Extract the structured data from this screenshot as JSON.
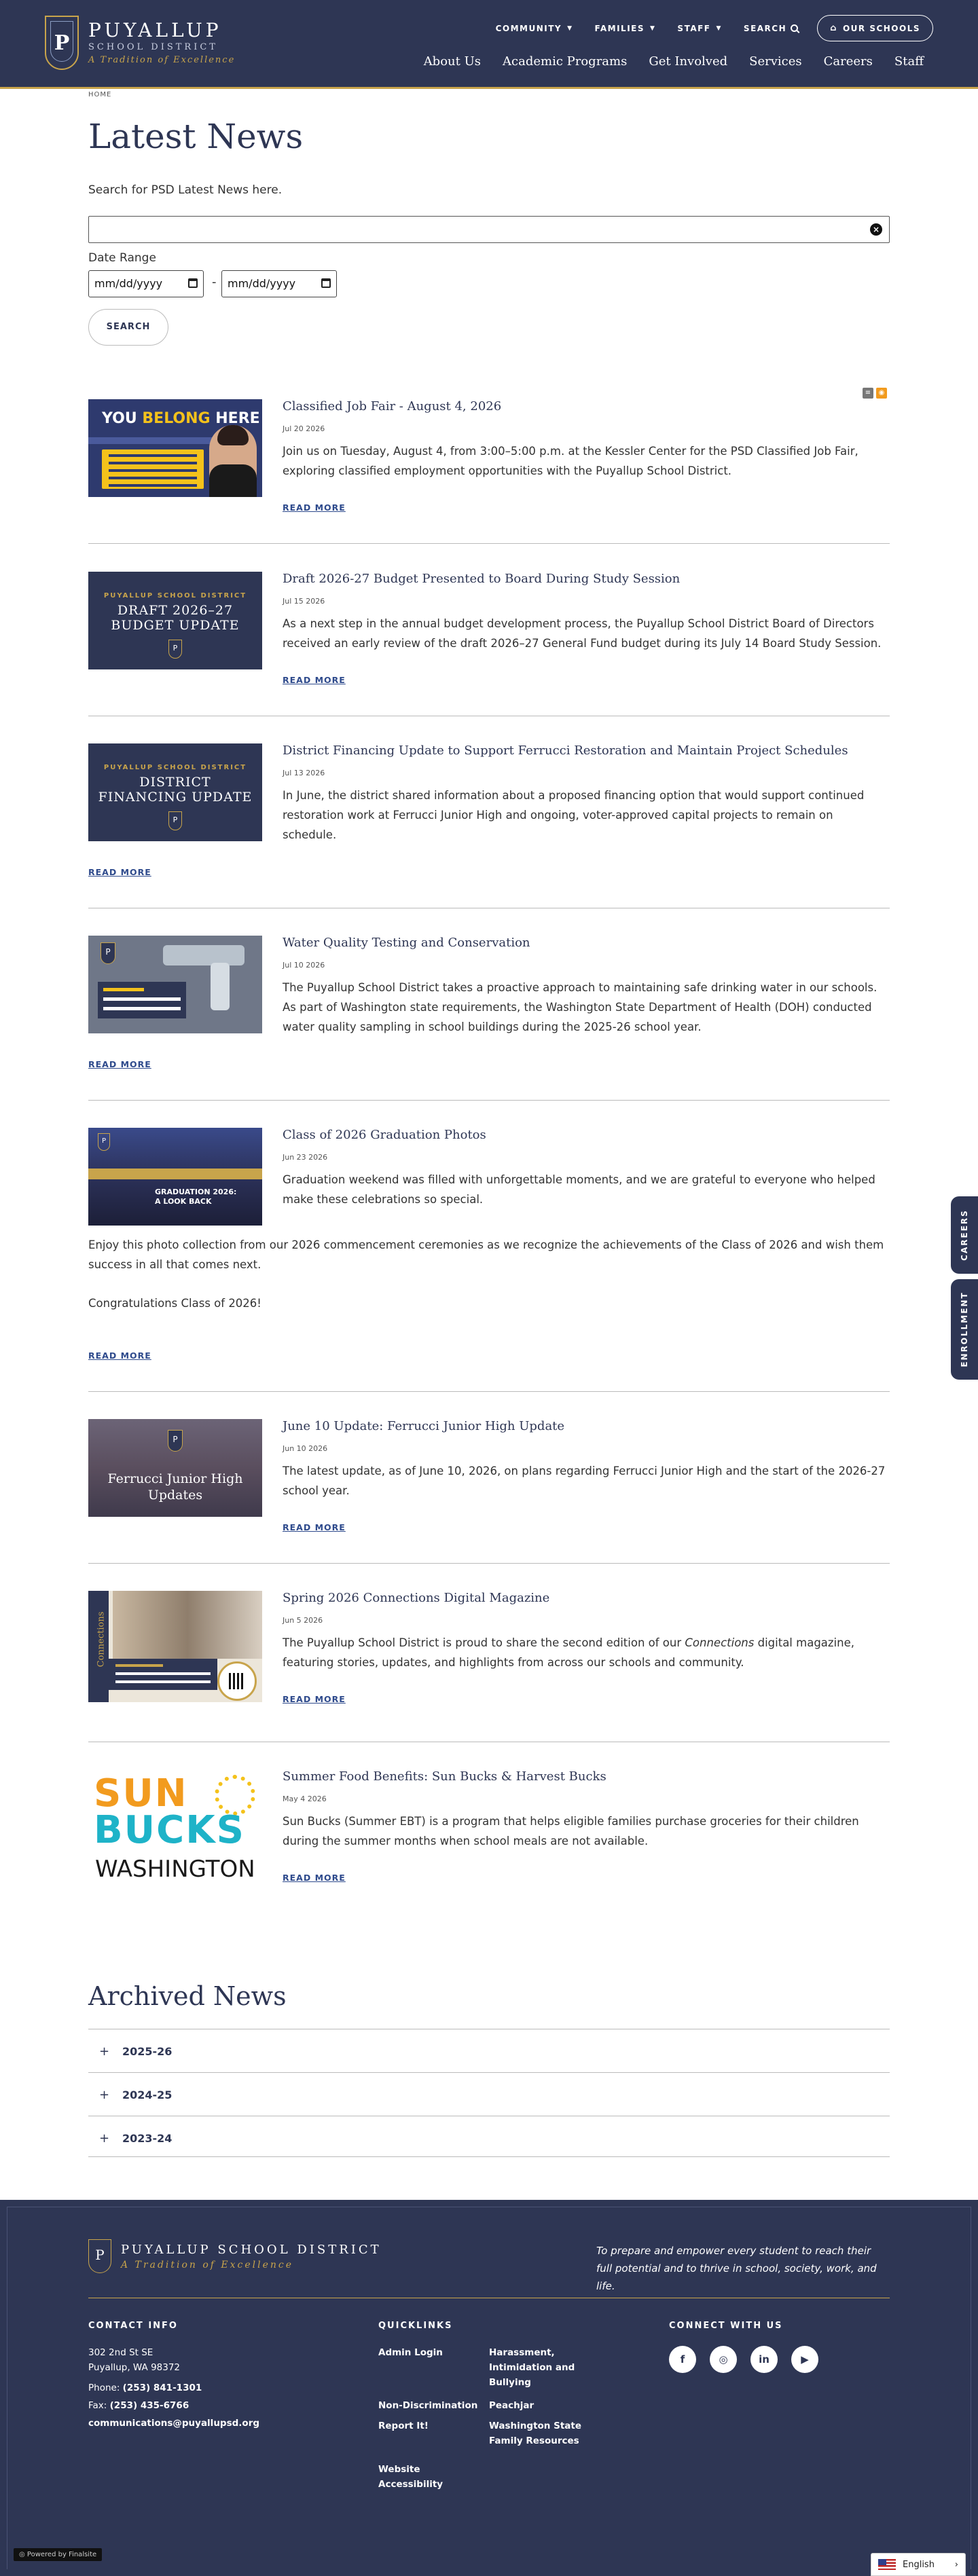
{
  "header": {
    "logo": {
      "name": "PUYALLUP",
      "sub": "SCHOOL DISTRICT",
      "tagline": "A Tradition of Excellence",
      "crest_letter": "P"
    },
    "utility": [
      {
        "label": "COMMUNITY",
        "icon": "chevron-down-icon"
      },
      {
        "label": "FAMILIES",
        "icon": "chevron-down-icon"
      },
      {
        "label": "STAFF",
        "icon": "chevron-down-icon"
      },
      {
        "label": "SEARCH",
        "icon": "search-icon"
      }
    ],
    "schools_button": "OUR SCHOOLS",
    "nav": [
      "About Us",
      "Academic Programs",
      "Get Involved",
      "Services",
      "Careers",
      "Staff"
    ]
  },
  "breadcrumb": "HOME",
  "page_title": "Latest News",
  "search": {
    "intro": "Search for PSD Latest News here.",
    "input_value": "",
    "date_label": "Date Range",
    "date_from": "mm/dd/yyyy",
    "date_to": "mm/dd/yyyy",
    "date_sep": "-",
    "button": "SEARCH"
  },
  "news": [
    {
      "title": "Classified Job Fair - August 4, 2026",
      "date": "Jul 20 2026",
      "body": "Join us on Tuesday, August 4, from 3:00–5:00 p.m. at the Kessler Center for the PSD Classified Job Fair, exploring classified employment opportunities with the Puyallup School District.",
      "read_more": "READ MORE",
      "thumb": {
        "line1": "YOU",
        "line2": "BELONG",
        "line3": "HERE"
      }
    },
    {
      "title": "Draft 2026-27 Budget Presented to Board During Study Session",
      "date": "Jul 15 2026",
      "body": "As a next step in the annual budget development process, the Puyallup School District Board of Directors received an early review of the draft 2026–27 General Fund budget during its July 14 Board Study Session.",
      "read_more": "READ MORE",
      "thumb": {
        "kicker": "PUYALLUP SCHOOL DISTRICT",
        "main1": "DRAFT 2026–27",
        "main2": "BUDGET UPDATE"
      }
    },
    {
      "title": "District Financing Update to Support Ferrucci Restoration and Maintain Project Schedules",
      "date": "Jul 13 2026",
      "body": "In June, the district shared information about a proposed financing option that would support continued restoration work at Ferrucci Junior High and ongoing, voter-approved capital projects to remain on schedule.",
      "read_more": "READ MORE",
      "thumb": {
        "kicker": "PUYALLUP SCHOOL DISTRICT",
        "main1": "DISTRICT",
        "main2": "FINANCING UPDATE"
      }
    },
    {
      "title": "Water Quality Testing and Conservation",
      "date": "Jul 10 2026",
      "body": "The Puyallup School District takes a proactive approach to maintaining safe drinking water in our schools. As part of Washington state requirements, the Washington State Department of Health (DOH) conducted water quality sampling in school buildings during the 2025-26 school year.",
      "read_more": "READ MORE"
    },
    {
      "title": "Class of 2026 Graduation Photos",
      "date": "Jun 23 2026",
      "body": "Graduation weekend was filled with unforgettable moments, and we are grateful to everyone who helped make these celebrations so special.",
      "extra1": "Enjoy this photo collection from our 2026 commencement ceremonies as we recognize the achievements of the Class of 2026 and wish them success in all that comes next.",
      "extra2": "Congratulations Class of 2026!",
      "read_more": "READ MORE",
      "thumb": {
        "line1": "GRADUATION 2026:",
        "line2": "A LOOK BACK"
      }
    },
    {
      "title": "June 10 Update: Ferrucci Junior High Update",
      "date": "Jun 10 2026",
      "body": "The latest update, as of June 10, 2026, on plans regarding Ferrucci Junior High and the start of the 2026-27 school year.",
      "read_more": "READ MORE",
      "thumb": {
        "line1": "Ferrucci Junior High",
        "line2": "Updates"
      }
    },
    {
      "title": "Spring 2026 Connections Digital Magazine",
      "date": "Jun 5 2026",
      "body_pre": "The Puyallup School District is proud to share the second edition of our ",
      "body_em": "Connections",
      "body_post": " digital magazine, featuring stories, updates, and highlights from across our schools and community.",
      "read_more": "READ MORE",
      "thumb": {
        "side": "Connections"
      }
    },
    {
      "title": "Summer Food Benefits: Sun Bucks & Harvest Bucks",
      "date": "May 4 2026",
      "body": "Sun Bucks (Summer EBT) is a program that helps eligible families purchase groceries for their children during the summer months when school meals are not available.",
      "read_more": "READ MORE",
      "thumb": {
        "line1": "SUN",
        "line2": "BUCKS",
        "line3": "WASHINGTON"
      }
    }
  ],
  "archived": {
    "title": "Archived News",
    "items": [
      "2025-26",
      "2024-25",
      "2023-24"
    ]
  },
  "side_tabs": [
    "CAREERS",
    "ENROLLMENT"
  ],
  "footer": {
    "logo_name": "PUYALLUP SCHOOL DISTRICT",
    "logo_tagline": "A Tradition of Excellence",
    "mission": "To prepare and empower every student to reach their full potential and to thrive in school, society, work, and life.",
    "contact": {
      "heading": "CONTACT INFO",
      "address1": "302 2nd St SE",
      "address2": "Puyallup, WA 98372",
      "phone_label": "Phone:",
      "phone": "(253) 841-1301",
      "fax_label": "Fax:",
      "fax": "(253) 435-6766",
      "email": "communications@puyallupsd.org"
    },
    "quicklinks": {
      "heading": "QUICKLINKS",
      "col1": [
        "Admin Login",
        "Non-Discrimination",
        "Report It!",
        "Website Accessibility"
      ],
      "col2": [
        "Harassment, Intimidation and Bullying",
        "Peachjar",
        "Washington State Family Resources"
      ]
    },
    "connect": {
      "heading": "CONNECT WITH US",
      "icons": [
        "facebook-icon",
        "instagram-icon",
        "linkedin-icon",
        "youtube-icon"
      ]
    },
    "powered_by": "Powered by Finalsite",
    "language": "English"
  },
  "colors": {
    "navy": "#2e3654",
    "gold": "#c8a44b",
    "link": "#2e4a8c"
  }
}
